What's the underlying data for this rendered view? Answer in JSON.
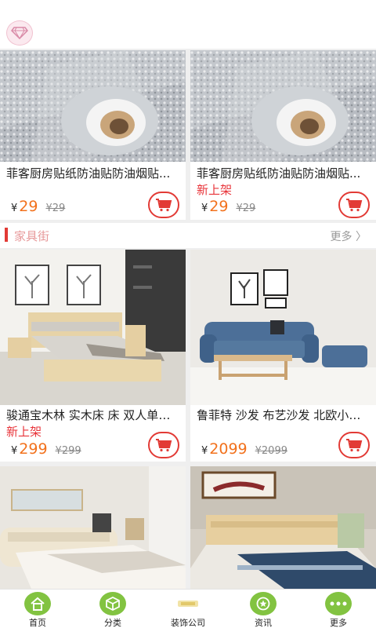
{
  "header": {
    "logo_icon": "diamond-logo-icon"
  },
  "row1": [
    {
      "title": "菲客厨房贴纸防油贴防油烟贴...",
      "new_label": "",
      "currency": "¥",
      "price": "29",
      "old_price": "¥29"
    },
    {
      "title": "菲客厨房贴纸防油贴防油烟贴...",
      "new_label": "新上架",
      "currency": "¥",
      "price": "29",
      "old_price": "¥29"
    }
  ],
  "section": {
    "title": "家具街",
    "more": "更多 〉"
  },
  "row2": [
    {
      "title": "骏通宝木林 实木床 床 双人单人...",
      "new_label": "新上架",
      "currency": "¥",
      "price": "299",
      "old_price": "¥299"
    },
    {
      "title": "鲁菲特 沙发 布艺沙发 北欧小户...",
      "new_label": "",
      "currency": "¥",
      "price": "2099",
      "old_price": "¥2099"
    }
  ],
  "tabbar": [
    {
      "label": "首页",
      "icon": "home-icon"
    },
    {
      "label": "分类",
      "icon": "box-icon"
    },
    {
      "label": "装饰公司",
      "icon": "company-logo-icon"
    },
    {
      "label": "资讯",
      "icon": "star-chat-icon"
    },
    {
      "label": "更多",
      "icon": "more-dots-icon"
    }
  ],
  "colors": {
    "accent_red": "#e23a35",
    "price_orange": "#f2711c",
    "tab_green": "#82c341"
  }
}
